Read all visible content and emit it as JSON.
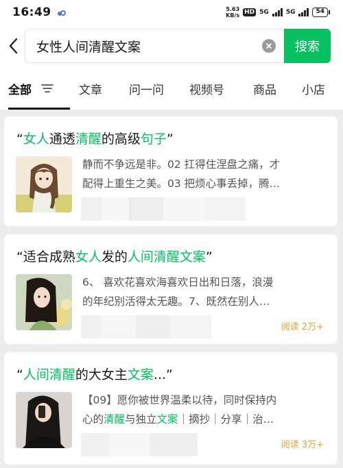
{
  "status_bar": {
    "time": "16:49",
    "net_speed_value": "5.63",
    "net_speed_unit": "KB/s",
    "hd_badge": "HD",
    "signal_1": "5G",
    "signal_2": "5G",
    "battery": "54"
  },
  "search": {
    "query": "女性人间清醒文案",
    "button_label": "搜索"
  },
  "tabs": [
    {
      "label": "全部"
    },
    {
      "label": "文章"
    },
    {
      "label": "问一问"
    },
    {
      "label": "视频号"
    },
    {
      "label": "商品"
    },
    {
      "label": "小店"
    }
  ],
  "results": [
    {
      "title_parts": [
        "“",
        "女人",
        "通透",
        "清醒",
        "的高级",
        "句子",
        "”"
      ],
      "snippet_line1": "静而不争远是非。02 扛得住涅盘之痛，才",
      "snippet_line2": "配得上重生之美。03 把烦心事丢掉，腾…",
      "reads": ""
    },
    {
      "title_parts": [
        "“适合成熟",
        "女人",
        "发的",
        "人间清醒文案",
        "”"
      ],
      "snippet_line1": "6、 喜欢花喜欢海喜欢日出和日落，浪漫",
      "snippet_line2": "的年纪别活得太无趣。7、既然在别人…",
      "reads": "阅读 2万+"
    },
    {
      "title_parts": [
        "“",
        "人间清醒",
        "的大女主",
        "文案",
        "...”"
      ],
      "snippet_line1": "【09】愿你被世界温柔以待，同时保持内",
      "snippet_line2_parts": [
        "心的",
        "清醒",
        "与独立",
        "文案",
        "｜摘抄｜分享｜治…"
      ],
      "reads": "阅读 3万+"
    }
  ],
  "colors": {
    "accent": "#07c160",
    "reads": "#e8a232",
    "background": "#ededed"
  },
  "icons": [
    "back-chevron-icon",
    "clear-icon",
    "filter-icon",
    "signal-icon",
    "battery-icon"
  ]
}
